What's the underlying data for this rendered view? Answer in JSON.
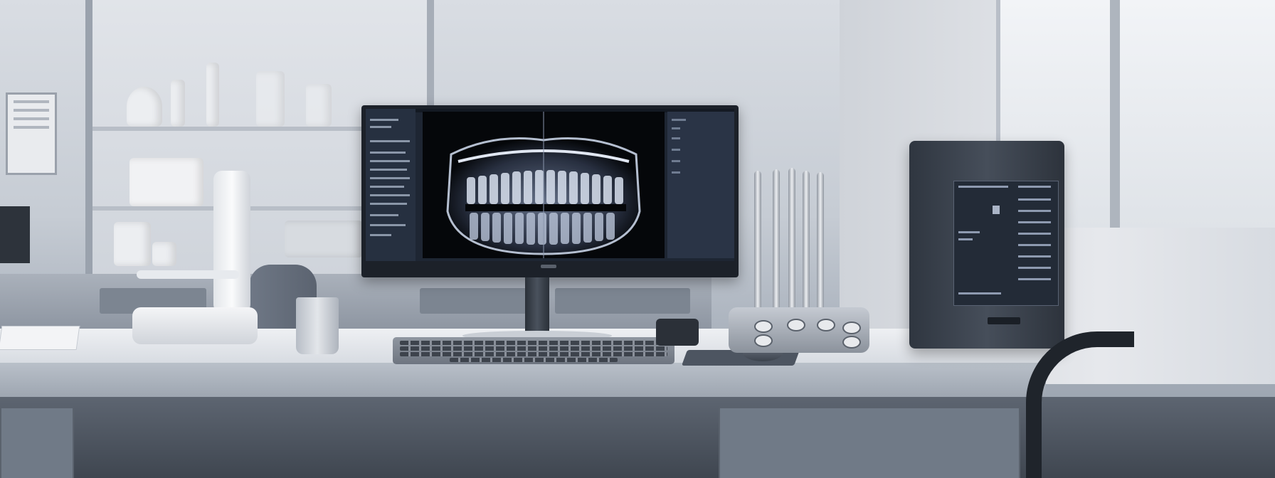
{
  "scene": {
    "description_tag": "",
    "colors": {
      "wall": "#d9dde3",
      "desk": "#eef0f3",
      "monitor_frame": "#1c2129",
      "screen_bg": "#1e2633",
      "xray_bg": "#05070a",
      "tower": "#2f3640"
    }
  },
  "monitor": {
    "app": "dental-xray-viewer"
  },
  "tower": {
    "panel": "status-panel"
  },
  "icons": [
    "tooth-xray-icon"
  ]
}
